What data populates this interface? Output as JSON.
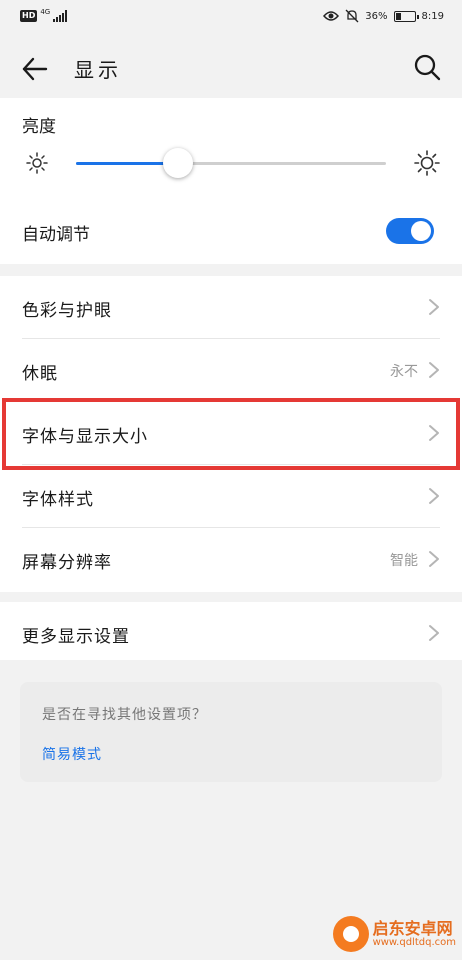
{
  "status_bar": {
    "network_badge": "HD",
    "network_type": "4G",
    "battery_percent": "36%",
    "battery_level": 0.36,
    "time": "8:19"
  },
  "header": {
    "title": "显示",
    "back_icon": "back-arrow-icon",
    "search_icon": "search-icon"
  },
  "brightness": {
    "label": "亮度",
    "level": 0.33,
    "auto_adjust_label": "自动调节",
    "auto_adjust_on": true
  },
  "menu": {
    "items": [
      {
        "label": "色彩与护眼",
        "value": ""
      },
      {
        "label": "休眠",
        "value": "永不"
      },
      {
        "label": "字体与显示大小",
        "value": ""
      },
      {
        "label": "字体样式",
        "value": ""
      },
      {
        "label": "屏幕分辨率",
        "value": "智能"
      }
    ],
    "more_label": "更多显示设置"
  },
  "suggestion": {
    "question": "是否在寻找其他设置项？",
    "link": "简易模式"
  },
  "watermark": {
    "name": "启东安卓网",
    "url": "www.qdltdq.com"
  },
  "colors": {
    "accent": "#1a73e8",
    "highlight_border": "#e53935"
  }
}
